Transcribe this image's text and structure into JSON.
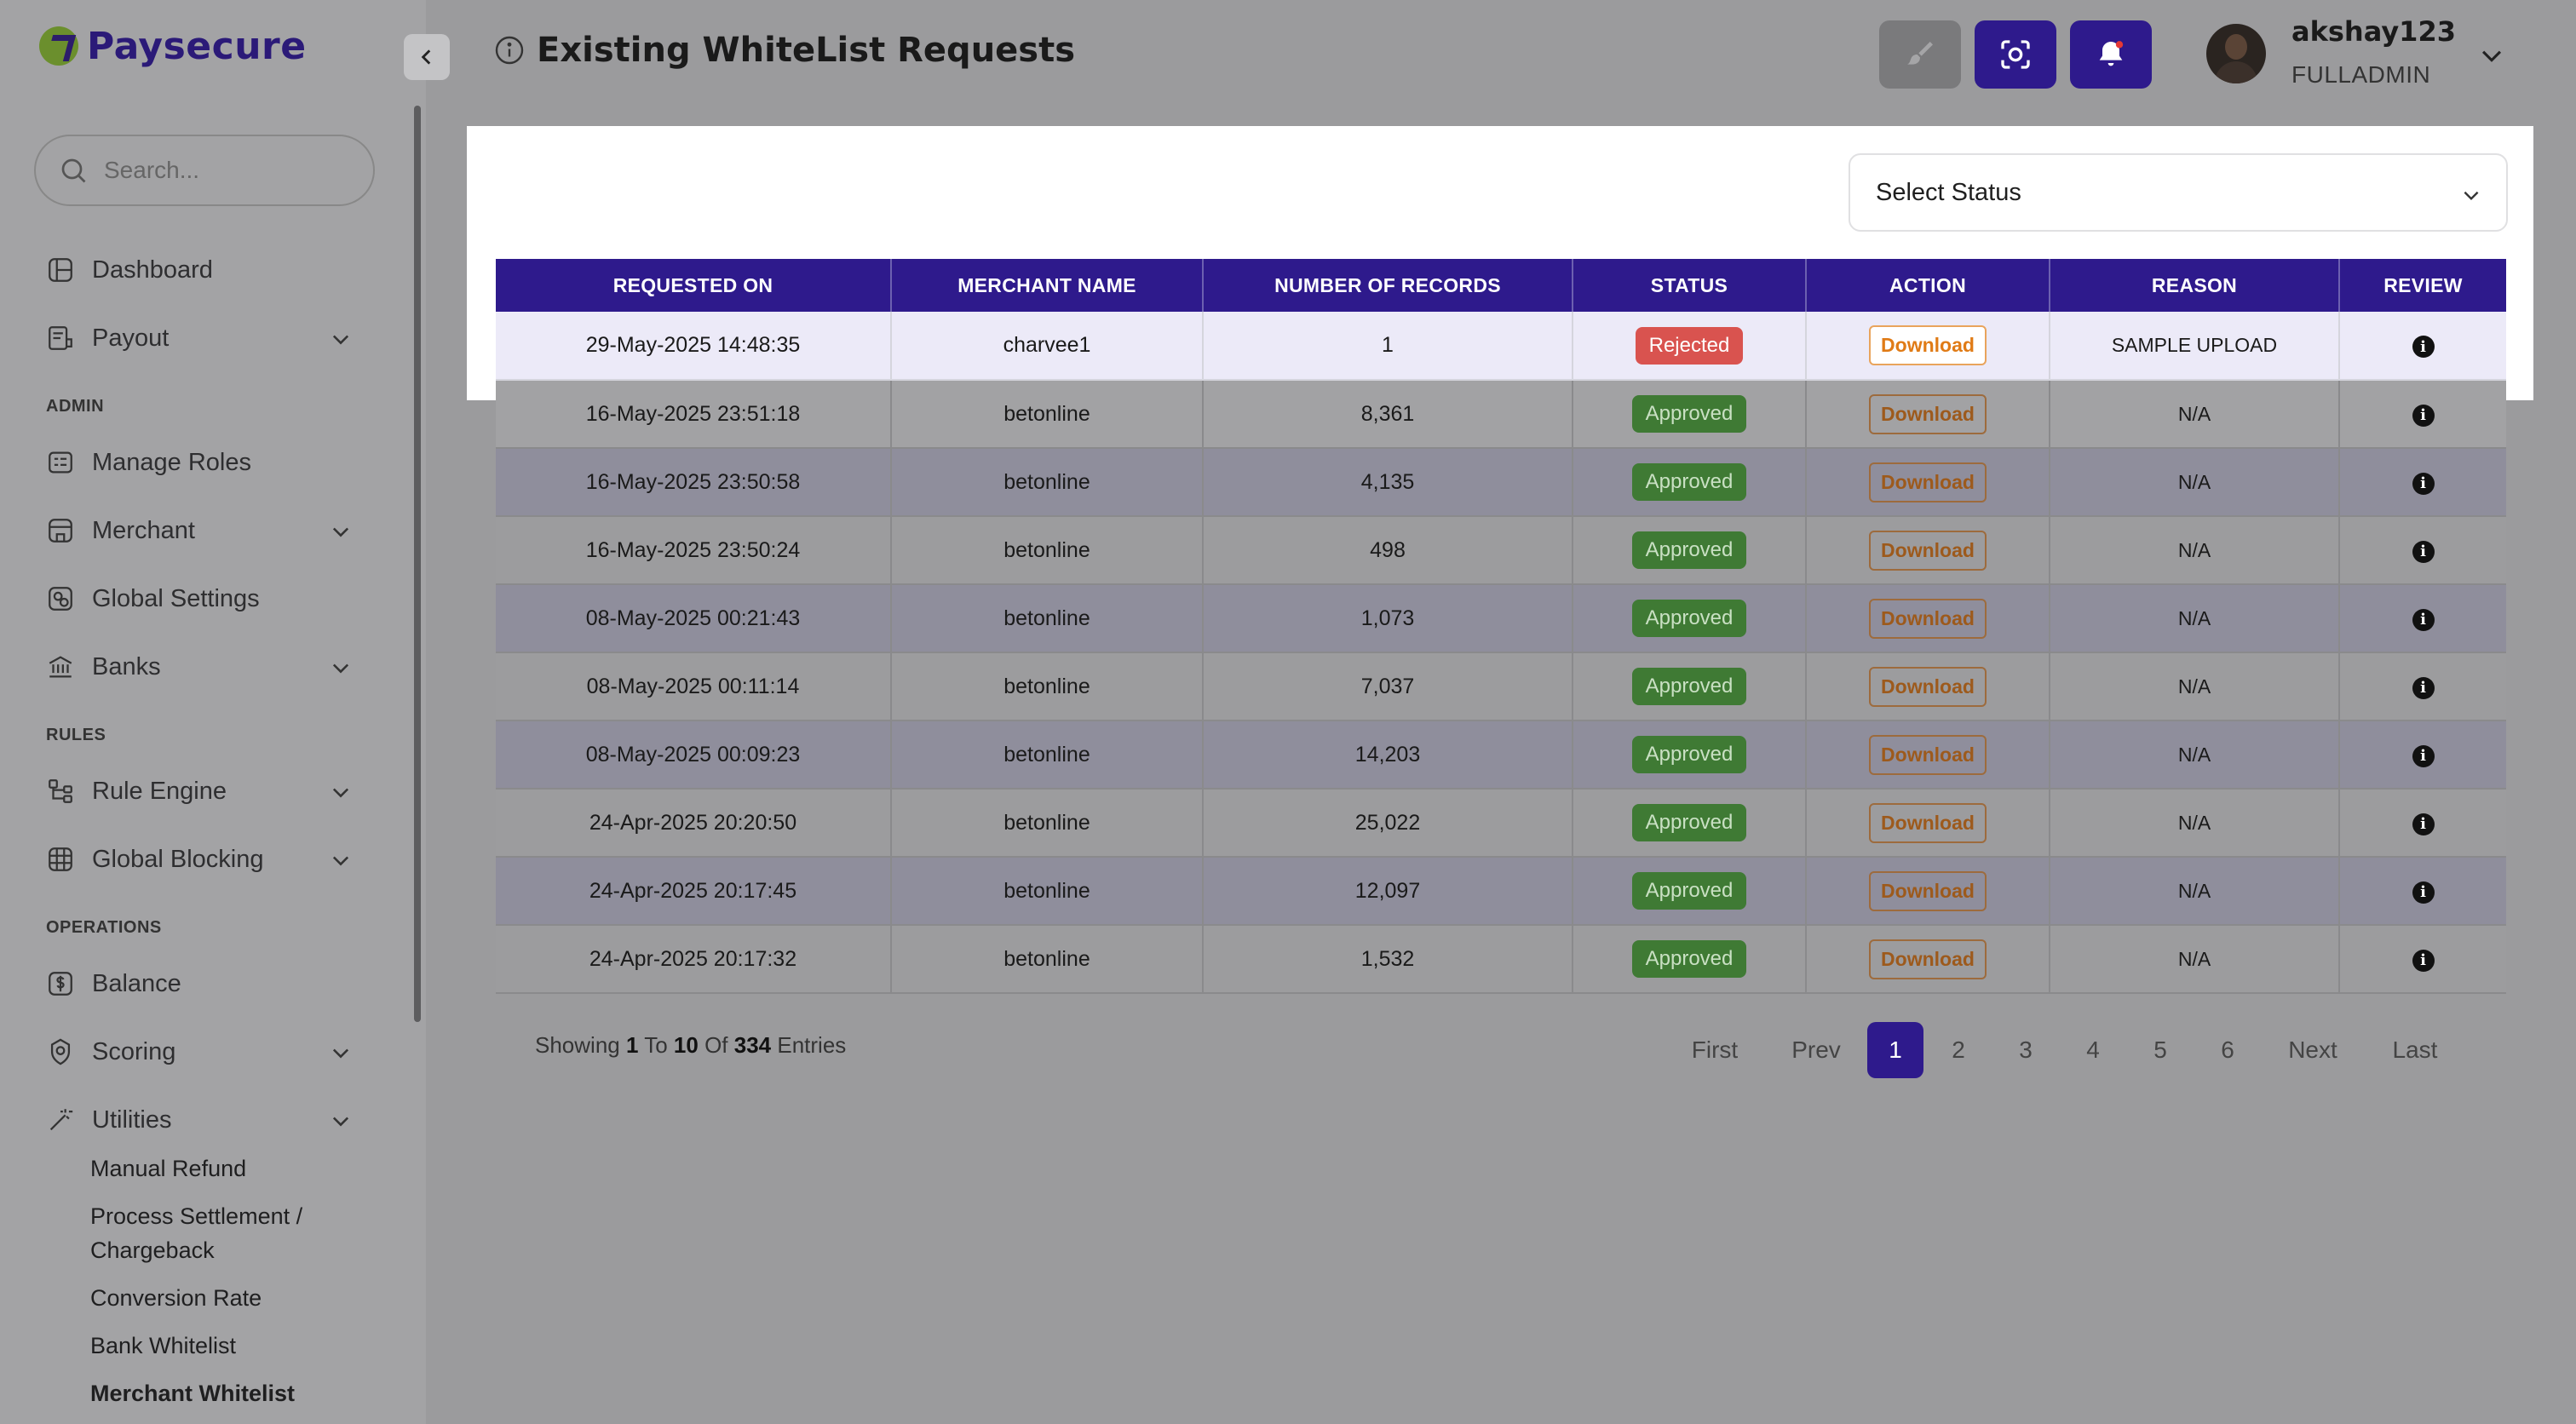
{
  "brand": {
    "name": "Paysecure"
  },
  "sidebar": {
    "search_placeholder": "Search...",
    "items": [
      {
        "label": "Dashboard",
        "icon": "dashboard-icon"
      },
      {
        "label": "Payout",
        "icon": "payout-icon"
      },
      {
        "label": "Manage Roles",
        "icon": "roles-icon"
      },
      {
        "label": "Merchant",
        "icon": "merchant-icon"
      },
      {
        "label": "Global Settings",
        "icon": "settings-icon"
      },
      {
        "label": "Banks",
        "icon": "bank-icon"
      },
      {
        "label": "Rule Engine",
        "icon": "rule-engine-icon"
      },
      {
        "label": "Global Blocking",
        "icon": "global-blocking-icon"
      },
      {
        "label": "Balance",
        "icon": "balance-icon"
      },
      {
        "label": "Scoring",
        "icon": "scoring-icon"
      },
      {
        "label": "Utilities",
        "icon": "utilities-icon"
      }
    ],
    "sections": {
      "admin": "ADMIN",
      "rules": "RULES",
      "operations": "OPERATIONS"
    },
    "utilities_sub": [
      "Manual Refund",
      "Process Settlement / Chargeback",
      "Conversion Rate",
      "Bank Whitelist",
      "Merchant Whitelist"
    ]
  },
  "header": {
    "title": "Existing WhiteList Requests",
    "user_name": "akshay123",
    "user_role": "FULLADMIN"
  },
  "filter": {
    "status_placeholder": "Select Status"
  },
  "table": {
    "columns": [
      "REQUESTED ON",
      "MERCHANT NAME",
      "NUMBER OF RECORDS",
      "STATUS",
      "ACTION",
      "REASON",
      "REVIEW"
    ],
    "action_label": "Download",
    "rows": [
      {
        "requested_on": "29-May-2025 14:48:35",
        "merchant": "charvee1",
        "records": "1",
        "status": "Rejected",
        "reason": "SAMPLE UPLOAD"
      },
      {
        "requested_on": "16-May-2025 23:51:18",
        "merchant": "betonline",
        "records": "8,361",
        "status": "Approved",
        "reason": "N/A"
      },
      {
        "requested_on": "16-May-2025 23:50:58",
        "merchant": "betonline",
        "records": "4,135",
        "status": "Approved",
        "reason": "N/A"
      },
      {
        "requested_on": "16-May-2025 23:50:24",
        "merchant": "betonline",
        "records": "498",
        "status": "Approved",
        "reason": "N/A"
      },
      {
        "requested_on": "08-May-2025 00:21:43",
        "merchant": "betonline",
        "records": "1,073",
        "status": "Approved",
        "reason": "N/A"
      },
      {
        "requested_on": "08-May-2025 00:11:14",
        "merchant": "betonline",
        "records": "7,037",
        "status": "Approved",
        "reason": "N/A"
      },
      {
        "requested_on": "08-May-2025 00:09:23",
        "merchant": "betonline",
        "records": "14,203",
        "status": "Approved",
        "reason": "N/A"
      },
      {
        "requested_on": "24-Apr-2025 20:20:50",
        "merchant": "betonline",
        "records": "25,022",
        "status": "Approved",
        "reason": "N/A"
      },
      {
        "requested_on": "24-Apr-2025 20:17:45",
        "merchant": "betonline",
        "records": "12,097",
        "status": "Approved",
        "reason": "N/A"
      },
      {
        "requested_on": "24-Apr-2025 20:17:32",
        "merchant": "betonline",
        "records": "1,532",
        "status": "Approved",
        "reason": "N/A"
      }
    ]
  },
  "footer": {
    "showing_prefix": "Showing",
    "from": "1",
    "to_word": "To",
    "to": "10",
    "of_word": "Of",
    "total": "334",
    "entries_word": "Entries"
  },
  "pagination": {
    "first": "First",
    "prev": "Prev",
    "pages": [
      "1",
      "2",
      "3",
      "4",
      "5",
      "6"
    ],
    "current": "1",
    "next": "Next",
    "last": "Last"
  }
}
